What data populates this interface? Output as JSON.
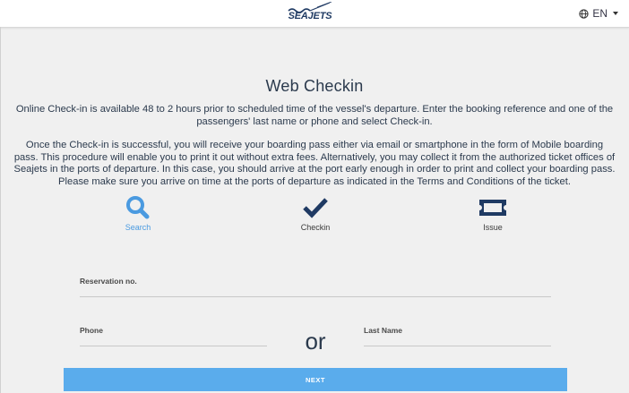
{
  "header": {
    "logo_text": "SEAJETS",
    "language": "EN"
  },
  "main": {
    "title": "Web Checkin",
    "paragraph1": "Online Check-in is available 48 to 2 hours prior to scheduled time of the vessel's departure. Enter the booking reference and one of the passengers' last name or phone and select Check-in.",
    "paragraph2": "Once the Check-in is successful, you will receive your boarding pass either via email or smartphone in the form of Mobile boarding pass. This procedure will enable you to print it out without extra fees. Alternatively, you may collect it from the authorized ticket offices of Seajets in the ports of departure. In this case, you should arrive at the port early enough in order to print and collect your boarding pass. Please make sure you arrive on time at the ports of departure as indicated in the Terms and Conditions of the ticket.",
    "steps": [
      {
        "label": "Search",
        "icon": "search-icon",
        "active": true
      },
      {
        "label": "Checkin",
        "icon": "checkmark-icon",
        "active": false
      },
      {
        "label": "Issue",
        "icon": "ticket-icon",
        "active": false
      }
    ]
  },
  "form": {
    "reservation_label": "Reservation no.",
    "phone_label": "Phone",
    "or_text": "or",
    "lastname_label": "Last Name",
    "next_label": "NEXT"
  },
  "colors": {
    "accent": "#5aacec",
    "active_step": "#4a9ae0",
    "dark": "#24364f",
    "background": "#f0f0f0"
  }
}
